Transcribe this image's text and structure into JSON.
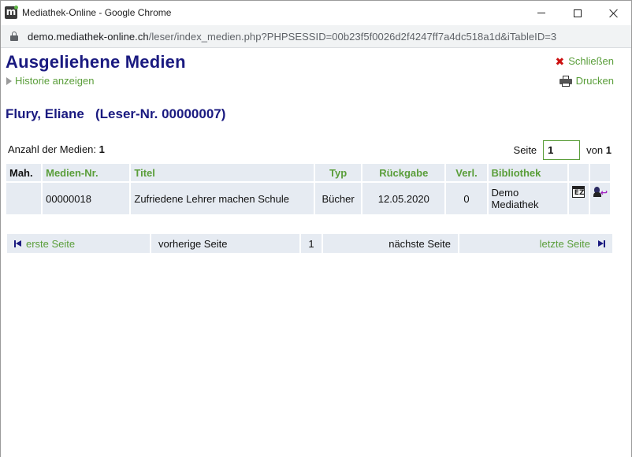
{
  "window": {
    "title": "Mediathek-Online - Google Chrome",
    "app_icon_letter": "m"
  },
  "address": {
    "host": "demo.mediathek-online.ch",
    "path": "/leser/index_medien.php?PHPSESSID=00b23f5f0026d2f4247ff7a4dc518a1d&iTableID=3"
  },
  "header": {
    "title": "Ausgeliehene Medien",
    "history_link": "Historie anzeigen",
    "close_link": "Schließen",
    "print_link": "Drucken"
  },
  "reader": {
    "name": "Flury, Eliane",
    "number_label": "(Leser-Nr. 00000007)"
  },
  "summary": {
    "count_label": "Anzahl der Medien:",
    "count_value": "1",
    "page_label": "Seite",
    "page_value": "1",
    "of_label": "von",
    "page_total": "1"
  },
  "table": {
    "columns": [
      "Mah.",
      "Medien-Nr.",
      "Titel",
      "Typ",
      "Rückgabe",
      "Verl.",
      "Bibliothek"
    ],
    "rows": [
      {
        "mah": "",
        "medien_nr": "00000018",
        "titel": "Zufriedene Lehrer machen Schule",
        "typ": "Bücher",
        "rueckgabe": "12.05.2020",
        "verl": "0",
        "bibliothek": "Demo Mediathek",
        "calendar_icon_text": "EZ"
      }
    ]
  },
  "pager": {
    "first": "erste Seite",
    "prev": "vorherige Seite",
    "current": "1",
    "next": "nächste Seite",
    "last": "letzte Seite"
  },
  "colors": {
    "title_blue": "#1a1a80",
    "link_green": "#5a9e3a",
    "row_bg": "#e6ebf2",
    "close_red": "#cc1111"
  },
  "icons": [
    "app-logo-icon",
    "lock-icon",
    "minimize-icon",
    "maximize-icon",
    "close-window-icon",
    "triangle-right-icon",
    "close-x-icon",
    "printer-icon",
    "calendar-extend-icon",
    "person-return-icon",
    "skip-first-icon",
    "skip-last-icon"
  ]
}
